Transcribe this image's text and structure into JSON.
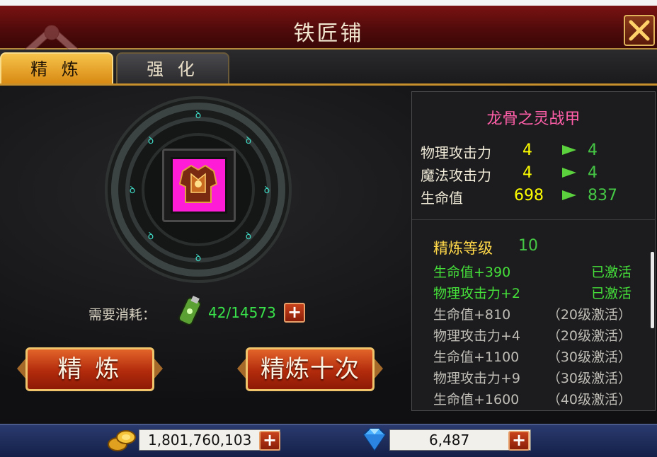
{
  "window": {
    "title": "铁匠铺"
  },
  "tabs": [
    {
      "label": "精 炼",
      "active": true
    },
    {
      "label": "强 化",
      "active": false
    }
  ],
  "refine": {
    "cost_label": "需要消耗：",
    "cost_value": "42/14573",
    "buttons": {
      "refine_once": "精 炼",
      "refine_ten": "精炼十次"
    }
  },
  "item": {
    "name": "龙骨之灵战甲",
    "stats": [
      {
        "name": "物理攻击力",
        "current": "4",
        "next": "4"
      },
      {
        "name": "魔法攻击力",
        "current": "4",
        "next": "4"
      },
      {
        "name": "生命值",
        "current": "698",
        "next": "837"
      }
    ],
    "refine_level_label": "精炼等级",
    "refine_level": "10",
    "bonuses": [
      {
        "label": "生命值+390",
        "status": "已激活",
        "active": true
      },
      {
        "label": "物理攻击力+2",
        "status": "已激活",
        "active": true
      },
      {
        "label": "生命值+810",
        "status": "（20级激活）",
        "active": false
      },
      {
        "label": "物理攻击力+4",
        "status": "（20级激活）",
        "active": false
      },
      {
        "label": "生命值+1100",
        "status": "（30级激活）",
        "active": false
      },
      {
        "label": "物理攻击力+9",
        "status": "（30级激活）",
        "active": false
      },
      {
        "label": "生命值+1600",
        "status": "（40级激活）",
        "active": false
      }
    ]
  },
  "currency": {
    "gold": "1,801,760,103",
    "diamonds": "6,487"
  },
  "colors": {
    "accent": "#d88a14",
    "header": "#6a1010",
    "active_green": "#45e03a",
    "stat_yellow": "#ffff00",
    "item_pink": "#ff5fa8"
  },
  "icons": {
    "close": "close-icon",
    "gold": "gold-coin-icon",
    "diamond": "diamond-icon",
    "material": "refine-stone-icon",
    "armor": "armor-icon",
    "plus": "plus-icon"
  }
}
